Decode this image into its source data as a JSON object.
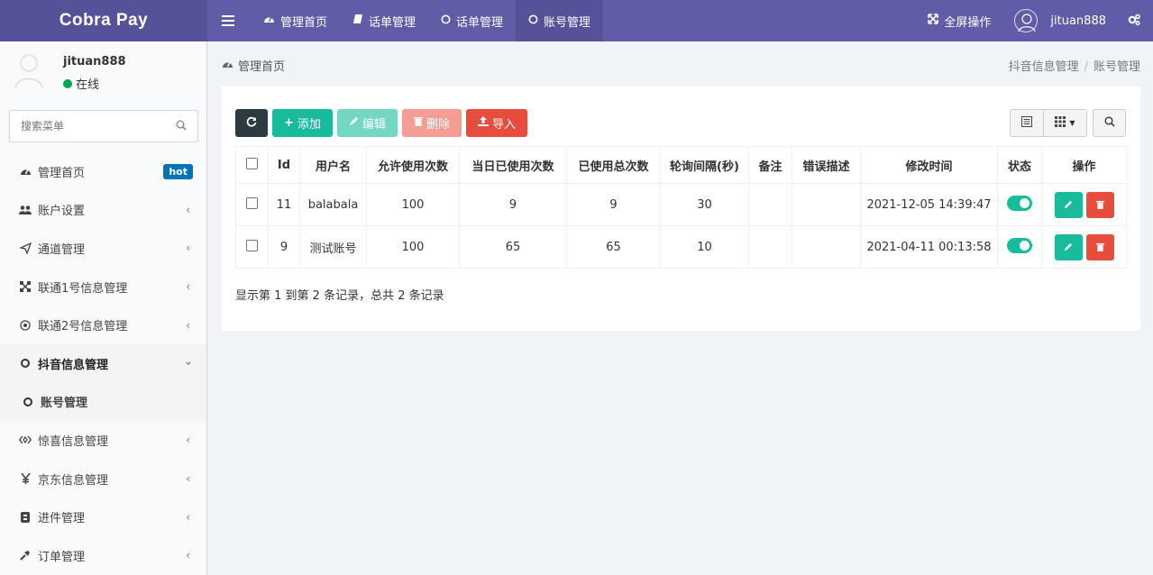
{
  "brand": "Cobra Pay",
  "topnav": [
    {
      "label": "管理首页",
      "icon": "dashboard-icon"
    },
    {
      "label": "话单管理",
      "icon": "book-icon"
    },
    {
      "label": "话单管理",
      "icon": "circle-icon"
    },
    {
      "label": "账号管理",
      "icon": "circle-icon",
      "active": true
    }
  ],
  "topright": {
    "fullscreen": "全屏操作",
    "username": "jituan888"
  },
  "user": {
    "name": "jituan888",
    "status": "在线"
  },
  "search": {
    "placeholder": "搜索菜单"
  },
  "menu": [
    {
      "label": "管理首页",
      "icon": "dashboard-icon",
      "badge": "hot"
    },
    {
      "label": "账户设置",
      "icon": "users-icon"
    },
    {
      "label": "通道管理",
      "icon": "send-icon"
    },
    {
      "label": "联通1号信息管理",
      "icon": "sitemap-icon"
    },
    {
      "label": "联通2号信息管理",
      "icon": "target-icon"
    },
    {
      "label": "抖音信息管理",
      "icon": "circle-icon"
    },
    {
      "label": "账号管理",
      "icon": "circle-icon"
    },
    {
      "label": "惊喜信息管理",
      "icon": "code-icon"
    },
    {
      "label": "京东信息管理",
      "icon": "yen-icon"
    },
    {
      "label": "进件管理",
      "icon": "file-icon"
    },
    {
      "label": "订单管理",
      "icon": "wrench-icon"
    }
  ],
  "breadcrumb": {
    "left": "管理首页",
    "right": [
      "抖音信息管理",
      "账号管理"
    ]
  },
  "toolbar": {
    "add": "添加",
    "edit": "编辑",
    "delete": "删除",
    "import": "导入"
  },
  "table": {
    "headers": [
      "Id",
      "用户名",
      "允许使用次数",
      "当日已使用次数",
      "已使用总次数",
      "轮询间隔(秒)",
      "备注",
      "错误描述",
      "修改时间",
      "状态",
      "操作"
    ],
    "rows": [
      {
        "id": "11",
        "username": "balabala",
        "allowed": "100",
        "today": "9",
        "total": "9",
        "interval": "30",
        "remark": "",
        "error": "",
        "modified": "2021-12-05 14:39:47"
      },
      {
        "id": "9",
        "username": "测试账号",
        "allowed": "100",
        "today": "65",
        "total": "65",
        "interval": "10",
        "remark": "",
        "error": "",
        "modified": "2021-04-11 00:13:58"
      }
    ]
  },
  "summary": "显示第 1 到第 2 条记录，总共 2 条记录",
  "colors": {
    "header": "#605ca8",
    "accent_green": "#18bc9c",
    "accent_red": "#e74c3c",
    "dark": "#2c3b41"
  }
}
